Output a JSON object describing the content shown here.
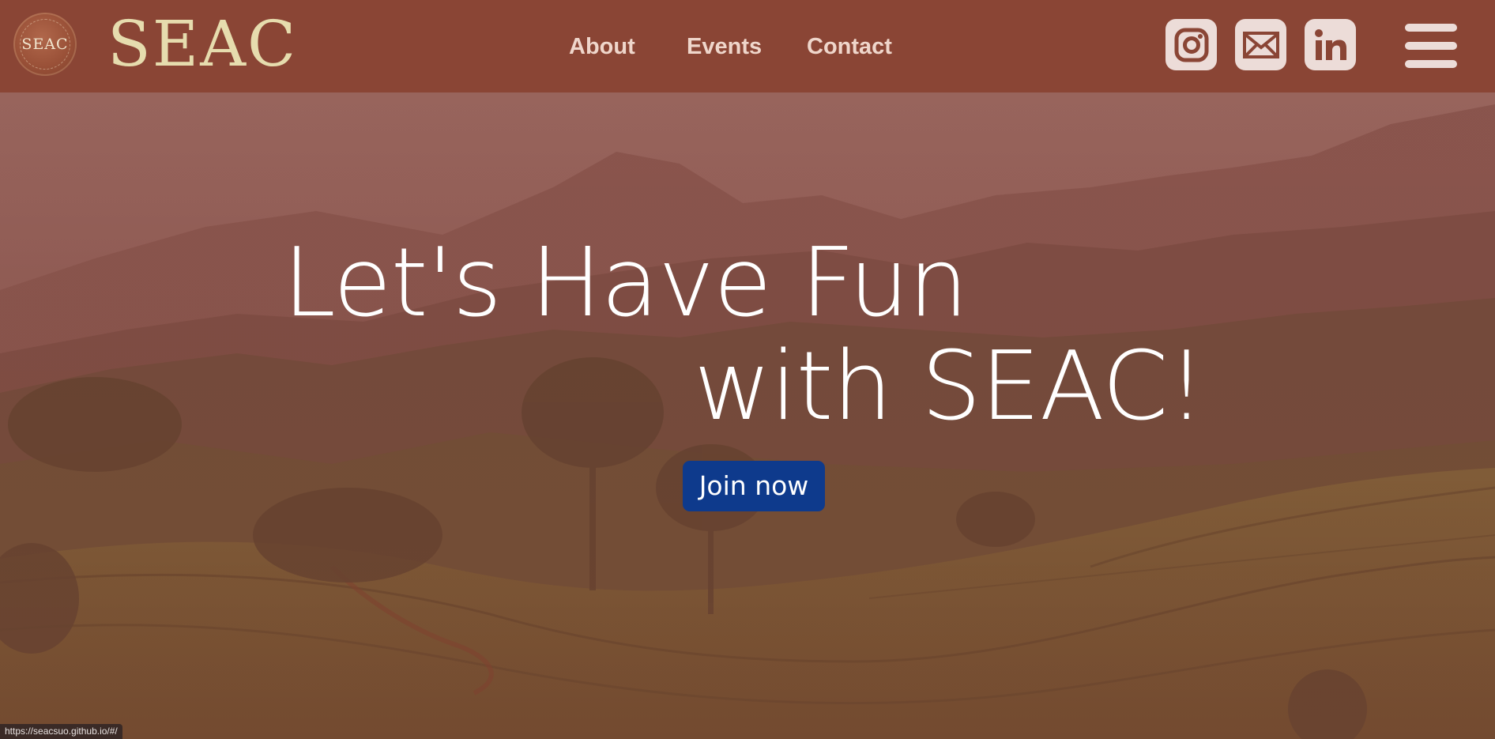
{
  "header": {
    "logo_seal_text": "SEAC",
    "logo_wordmark": "SEAC",
    "nav": {
      "about": "About",
      "events": "Events",
      "contact": "Contact"
    },
    "social_icons": [
      "instagram-icon",
      "email-icon",
      "linkedin-icon"
    ],
    "menu_icon": "hamburger-menu-icon"
  },
  "hero": {
    "headline_line1": "Let's Have Fun",
    "headline_line2": "with SEAC!",
    "cta_label": "Join now"
  },
  "status_bar": {
    "url": "https://seacsuo.github.io/#/"
  },
  "colors": {
    "header_bg": "#8a4535",
    "wordmark": "#e6dcae",
    "nav_text": "#efd6cb",
    "icon_tile": "#ecdcd8",
    "cta_bg": "#0e3a8c",
    "hero_overlay": "#8b4a3e"
  }
}
